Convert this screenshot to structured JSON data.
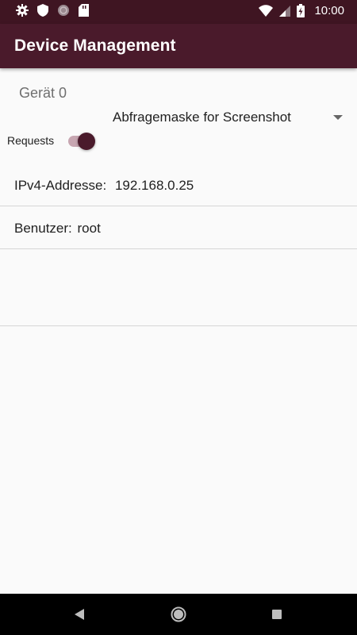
{
  "status_bar": {
    "time": "10:00",
    "left_icons": [
      "settings-icon",
      "shield-icon",
      "circle-icon",
      "sd-card-icon"
    ],
    "right_icons": [
      "wifi-icon",
      "signal-icon",
      "battery-icon"
    ]
  },
  "app_bar": {
    "title": "Device Management",
    "color": "#4a1a2b"
  },
  "device": {
    "title": "Gerät 0",
    "spinner_value": "Abfragemaske for Screenshot",
    "requests_label": "Requests",
    "requests_enabled": true,
    "ip_label": "IPv4-Addresse:",
    "ip_value": "192.168.0.25",
    "user_label": "Benutzer:",
    "user_value": "root"
  },
  "nav": {
    "buttons": [
      "back-icon",
      "home-icon",
      "recents-icon"
    ]
  }
}
